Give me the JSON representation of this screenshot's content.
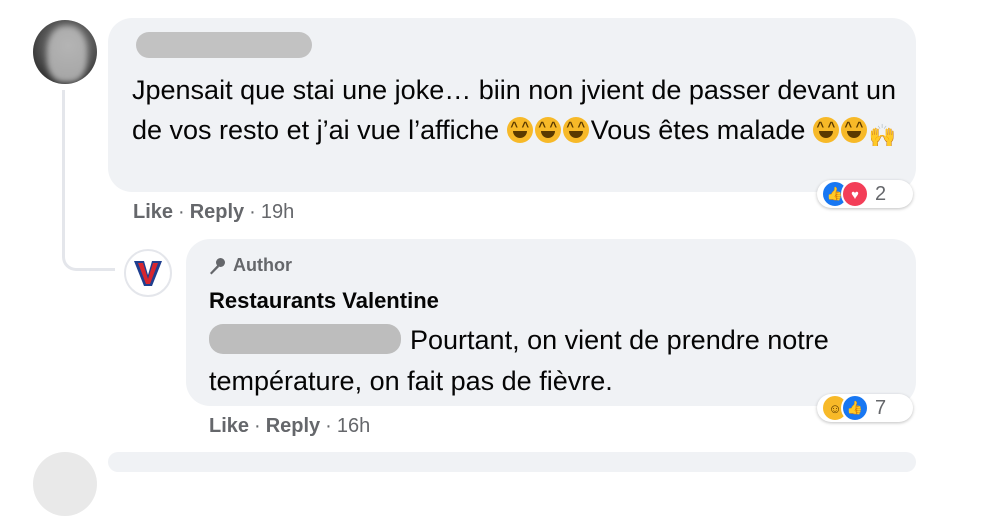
{
  "comment": {
    "text_parts": [
      "Jpensait que stai une joke… biin non jvient de passer devant un de vos resto et j’ai vue l’affiche ",
      "Vous êtes malade "
    ],
    "like_label": "Like",
    "reply_label": "Reply",
    "separator": "·",
    "time": "19h",
    "reaction_count": "2",
    "reaction_icons": [
      "like-icon",
      "love-icon"
    ]
  },
  "reply": {
    "badge_label": "Author",
    "author_name": "Restaurants Valentine",
    "text_line1": "Pourtant, on vient de prendre notre",
    "text_line2": "température, on fait pas de fièvre.",
    "like_label": "Like",
    "reply_label": "Reply",
    "separator": "·",
    "time": "16h",
    "reaction_count": "7",
    "reaction_icons": [
      "haha-icon",
      "like-icon"
    ],
    "avatar_letter": "V",
    "brand_colors": {
      "red": "#d7262e",
      "blue": "#1f3f8f"
    }
  },
  "colors": {
    "bubble": "#f0f2f5",
    "meta": "#65676b",
    "like_blue": "#1877f2",
    "love_red": "#f33e58",
    "haha_yellow": "#f7b928"
  }
}
